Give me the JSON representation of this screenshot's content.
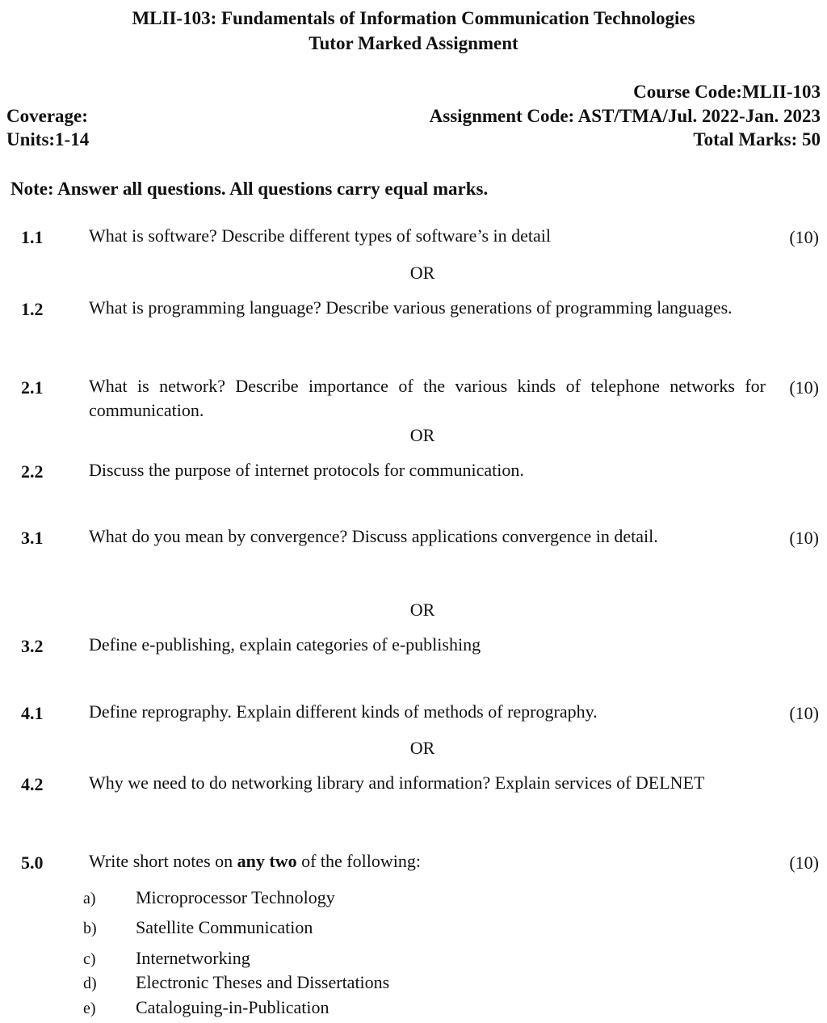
{
  "header": {
    "title_line1": "MLII-103: Fundamentals of Information Communication Technologies",
    "title_line2": "Tutor Marked Assignment",
    "course_code": "Course Code:MLII-103",
    "coverage": "Coverage:",
    "assignment_code": "Assignment Code: AST/TMA/Jul. 2022-Jan. 2023",
    "units": "Units:1-14",
    "total_marks": "Total Marks: 50"
  },
  "note": "Note: Answer all questions. All questions carry equal marks.",
  "or_label": "OR",
  "questions": [
    {
      "num": "1.1",
      "text": "What is software? Describe different types of software’s in detail",
      "marks": "(10)"
    },
    {
      "num": "1.2",
      "text": "What is programming language? Describe various generations of programming languages."
    },
    {
      "num": "2.1",
      "text": "What is network? Describe importance of the various kinds of telephone networks for communication.",
      "marks": "(10)"
    },
    {
      "num": "2.2",
      "text": "Discuss the purpose of internet protocols for communication."
    },
    {
      "num": "3.1",
      "text": "What do you mean by convergence? Discuss applications convergence in detail.",
      "marks": "(10)"
    },
    {
      "num": "3.2",
      "text": "Define e-publishing, explain categories of e-publishing"
    },
    {
      "num": "4.1",
      "text": "Define reprography. Explain different kinds of methods of reprography.",
      "marks": "(10)"
    },
    {
      "num": "4.2",
      "text": "Why we need to do networking library and information? Explain services of DELNET"
    },
    {
      "num": "5.0",
      "text_before": "Write short notes on ",
      "text_bold": "any two",
      "text_after": " of the following:",
      "marks": "(10)"
    }
  ],
  "short_notes": [
    {
      "label": "a)",
      "text": "Microprocessor Technology"
    },
    {
      "label": "b)",
      "text": "Satellite Communication"
    },
    {
      "label": "c)",
      "text": "Internetworking"
    },
    {
      "label": "d)",
      "text": "Electronic Theses and Dissertations"
    },
    {
      "label": "e)",
      "text": "Cataloguing-in-Publication"
    }
  ]
}
